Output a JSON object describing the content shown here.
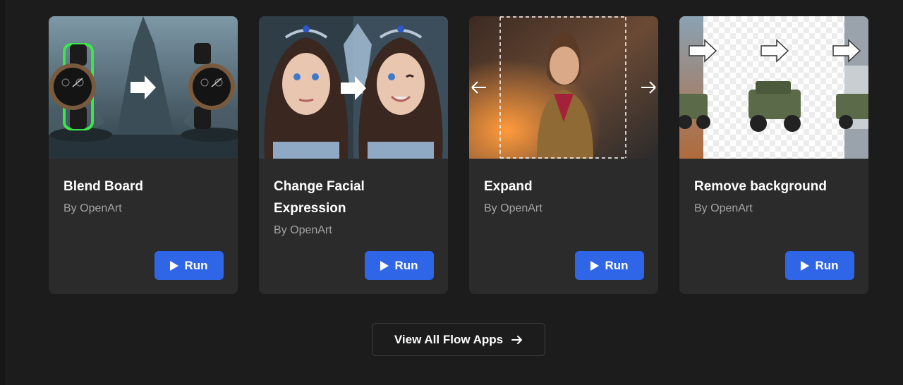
{
  "cards": [
    {
      "title": "Blend Board",
      "author": "By OpenArt",
      "run_label": "Run",
      "image_icon": "watch-blend-thumbnail"
    },
    {
      "title": "Change Facial Expression",
      "author": "By OpenArt",
      "run_label": "Run",
      "image_icon": "face-expression-thumbnail"
    },
    {
      "title": "Expand",
      "author": "By OpenArt",
      "run_label": "Run",
      "image_icon": "expand-image-thumbnail"
    },
    {
      "title": "Remove background",
      "author": "By OpenArt",
      "run_label": "Run",
      "image_icon": "remove-background-thumbnail"
    }
  ],
  "view_all": {
    "label": "View All Flow Apps",
    "icon": "arrow-right-icon"
  },
  "colors": {
    "background": "#1c1c1c",
    "card": "#2b2b2b",
    "accent": "#2f66e8",
    "muted_text": "#a3a3a3"
  }
}
